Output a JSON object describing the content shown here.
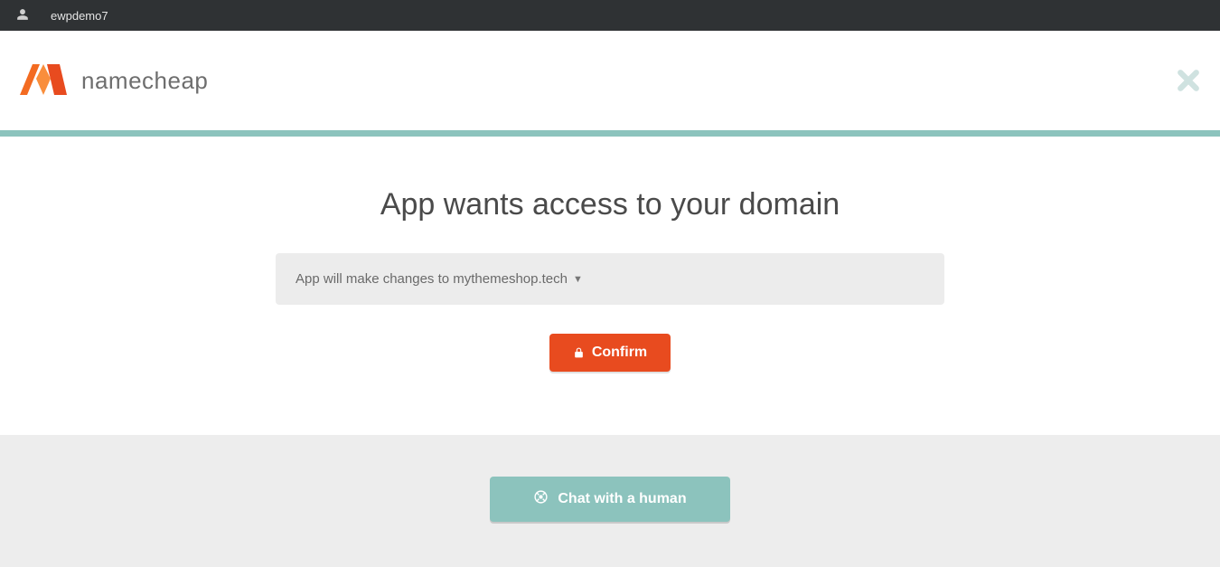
{
  "topbar": {
    "username": "ewpdemo7"
  },
  "brand": {
    "name": "namecheap"
  },
  "main": {
    "title": "App wants access to your domain",
    "domain_prompt_prefix": "App will make changes to ",
    "domain": "mythemeshop.tech",
    "confirm_label": "Confirm"
  },
  "footer": {
    "chat_label": "Chat with a human"
  },
  "colors": {
    "accent_teal": "#8cc3bd",
    "accent_orange": "#e84b1f",
    "topbar_bg": "#2f3234"
  }
}
